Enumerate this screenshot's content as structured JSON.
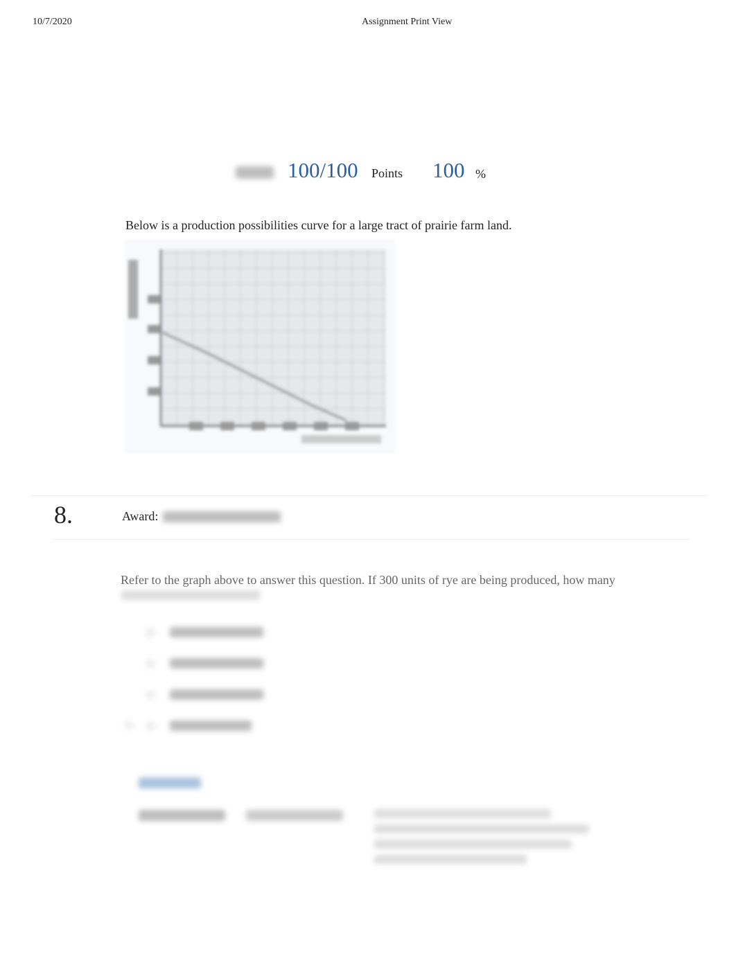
{
  "header": {
    "date": "10/7/2020",
    "title": "Assignment Print View"
  },
  "score": {
    "value": "100/100",
    "points_label": "Points",
    "percent": "100",
    "percent_sign": "%"
  },
  "intro": "Below is a production possibilities curve for a large tract of prairie farm land.",
  "chart_data": {
    "type": "line",
    "title": "",
    "grid": true,
    "note": "blurred, values not legible"
  },
  "question": {
    "number": "8.",
    "award_label": "Award:",
    "text": "Refer to the graph above to answer this question. If 300 units of rye are being produced, how many"
  },
  "colors": {
    "accent": "#2c5f9e"
  }
}
